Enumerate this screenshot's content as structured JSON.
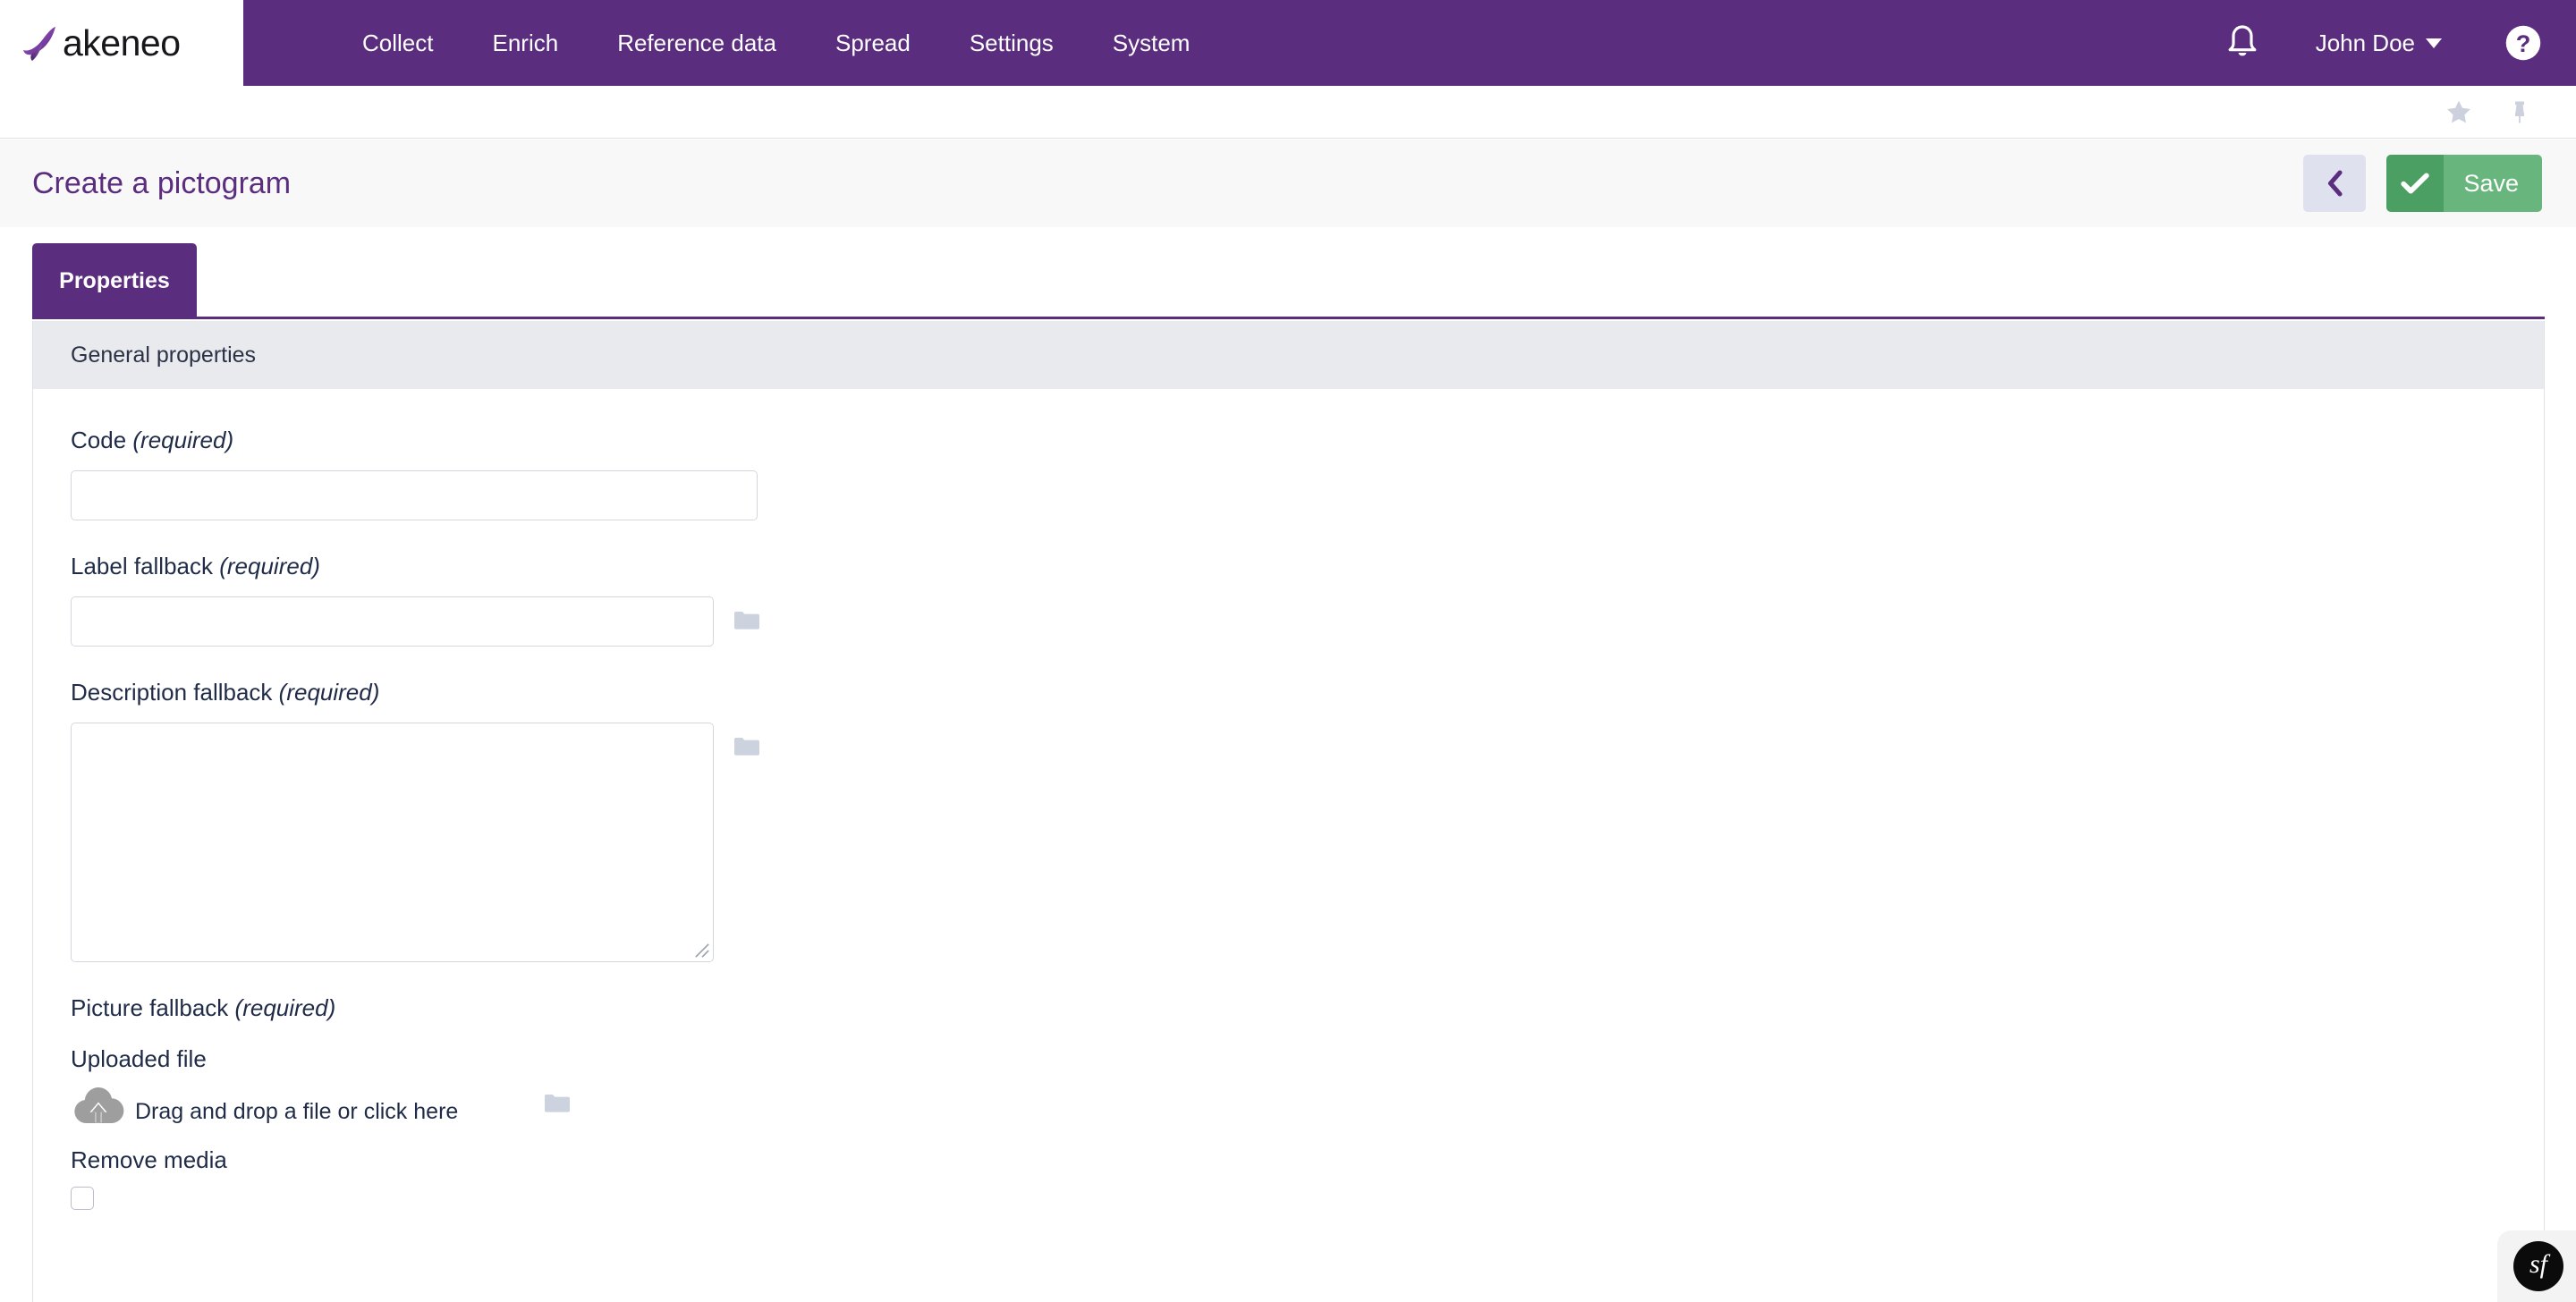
{
  "brand": {
    "logo_word": "akeneo",
    "logo_icon": "akeneo-leaf-icon",
    "primary_color": "#5b2d7e"
  },
  "topnav": {
    "items": [
      {
        "label": "Collect"
      },
      {
        "label": "Enrich"
      },
      {
        "label": "Reference data"
      },
      {
        "label": "Spread"
      },
      {
        "label": "Settings"
      },
      {
        "label": "System"
      }
    ],
    "notifications_icon": "bell-icon",
    "user": {
      "name": "John Doe",
      "caret_icon": "chevron-down-icon"
    },
    "help_icon": "help-circle-icon"
  },
  "subbar": {
    "favorite_icon": "star-icon",
    "pin_icon": "pin-icon"
  },
  "pageheader": {
    "title": "Create a pictogram",
    "back_icon": "chevron-left-icon",
    "save_label": "Save",
    "save_check_icon": "check-icon",
    "save_color_dark": "#4c9f62",
    "save_color_light": "#68b67d",
    "back_bg_color": "#dfe1ef"
  },
  "tabs": [
    {
      "label": "Properties",
      "active": true
    }
  ],
  "panel": {
    "section_title": "General properties",
    "fields": [
      {
        "label": "Code",
        "required_text": "(required)",
        "type": "text",
        "value": "",
        "placeholder": "",
        "has_folder_icon": false
      },
      {
        "label": "Label fallback",
        "required_text": "(required)",
        "type": "text",
        "value": "",
        "placeholder": "",
        "has_folder_icon": true
      },
      {
        "label": "Description fallback",
        "required_text": "(required)",
        "type": "textarea",
        "value": "",
        "placeholder": "",
        "has_folder_icon": true
      }
    ],
    "picture": {
      "label": "Picture fallback",
      "required_text": "(required)",
      "uploaded_file_label": "Uploaded file",
      "dropzone_text": "Drag and drop a file or click here",
      "dropzone_icon": "cloud-upload-icon",
      "folder_icon": "folder-icon"
    },
    "remove_media": {
      "label": "Remove media",
      "checked": false
    }
  },
  "debug_toolbar": {
    "symfony_label": "sf"
  }
}
